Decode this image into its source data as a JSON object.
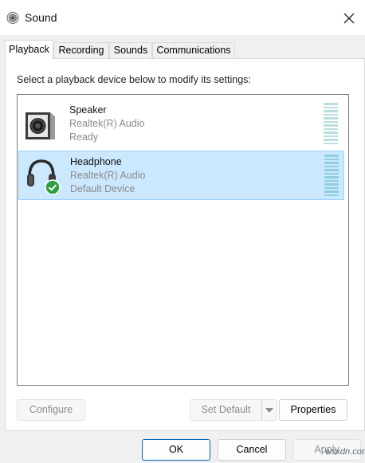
{
  "window": {
    "title": "Sound",
    "icon": "speaker-icon",
    "close_icon": "close-icon"
  },
  "tabs": [
    {
      "label": "Playback",
      "active": true
    },
    {
      "label": "Recording",
      "active": false
    },
    {
      "label": "Sounds",
      "active": false
    },
    {
      "label": "Communications",
      "active": false
    }
  ],
  "panel": {
    "instruction": "Select a playback device below to modify its settings:"
  },
  "devices": [
    {
      "name": "Speaker",
      "driver": "Realtek(R) Audio",
      "status": "Ready",
      "icon": "speaker-icon",
      "selected": false
    },
    {
      "name": "Headphone",
      "driver": "Realtek(R) Audio",
      "status": "Default Device",
      "icon": "headphone-icon",
      "default_badge_icon": "checkmark-icon",
      "selected": true
    }
  ],
  "panel_buttons": {
    "configure": "Configure",
    "set_default": "Set Default",
    "properties": "Properties"
  },
  "dialog_buttons": {
    "ok": "OK",
    "cancel": "Cancel",
    "apply": "Apply"
  },
  "watermark": "wsxdn.com",
  "colors": {
    "selection_bg": "#cce8ff",
    "selection_border": "#99d1ff",
    "badge_green": "#2ea043",
    "ok_border": "#0067c0"
  }
}
